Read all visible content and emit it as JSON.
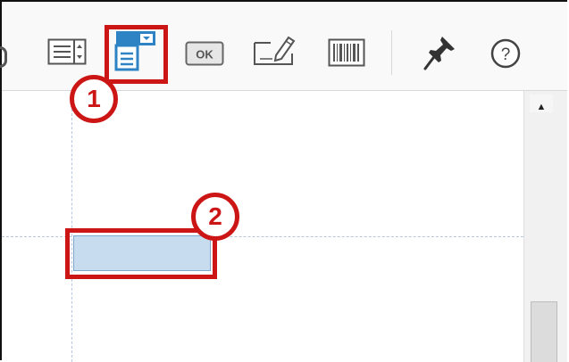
{
  "toolbar": {
    "tools": [
      {
        "name": "list-box-tool",
        "icon": "list-box-icon"
      },
      {
        "name": "dropdown-tool",
        "icon": "dropdown-field-icon",
        "highlighted": true
      },
      {
        "name": "ok-button-tool",
        "icon": "ok-button-icon",
        "label": "OK"
      },
      {
        "name": "signature-tool",
        "icon": "signature-field-icon"
      },
      {
        "name": "barcode-tool",
        "icon": "barcode-icon"
      },
      {
        "name": "pin-tool",
        "icon": "pushpin-icon"
      },
      {
        "name": "help-tool",
        "icon": "help-icon",
        "label": "?"
      }
    ]
  },
  "callouts": [
    {
      "number": "1"
    },
    {
      "number": "2"
    }
  ],
  "colors": {
    "callout_red": "#cc1515",
    "accent_blue": "#2d83c4",
    "field_fill": "#c7dcee",
    "guide_line": "#b6c6e0"
  }
}
